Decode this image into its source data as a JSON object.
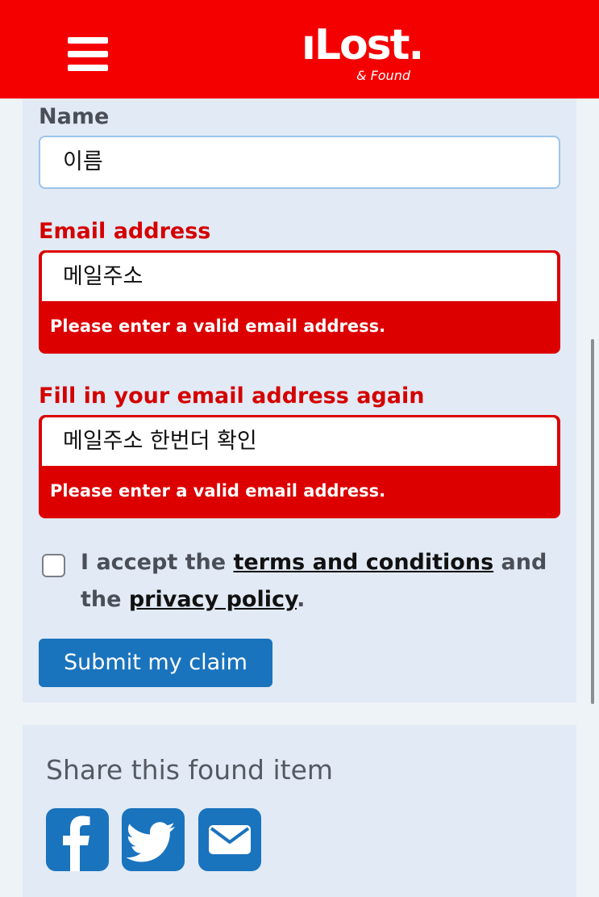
{
  "header": {
    "logo_main": "ıLost.",
    "logo_sub": "& Found",
    "menu_icon": "hamburger-menu-icon"
  },
  "form": {
    "name_label": "Name",
    "name_value": "이름",
    "email_label": "Email address",
    "email_value": "메일주소",
    "email_error": "Please enter a valid email address.",
    "confirm_label": "Fill in your email address again",
    "confirm_value": "메일주소 한번더 확인",
    "confirm_error": "Please enter a valid email address.",
    "consent_prefix": "I accept the ",
    "terms_link": "terms and conditions",
    "consent_middle": " and the ",
    "privacy_link": "privacy policy",
    "consent_suffix": ".",
    "submit_label": "Submit my claim"
  },
  "share": {
    "title": "Share this found item",
    "buttons": [
      "facebook-icon",
      "twitter-icon",
      "email-icon"
    ]
  },
  "colors": {
    "header_bg": "#f50000",
    "error": "#dc0000",
    "primary": "#1a73bd",
    "card_bg": "#e1eaf5"
  }
}
